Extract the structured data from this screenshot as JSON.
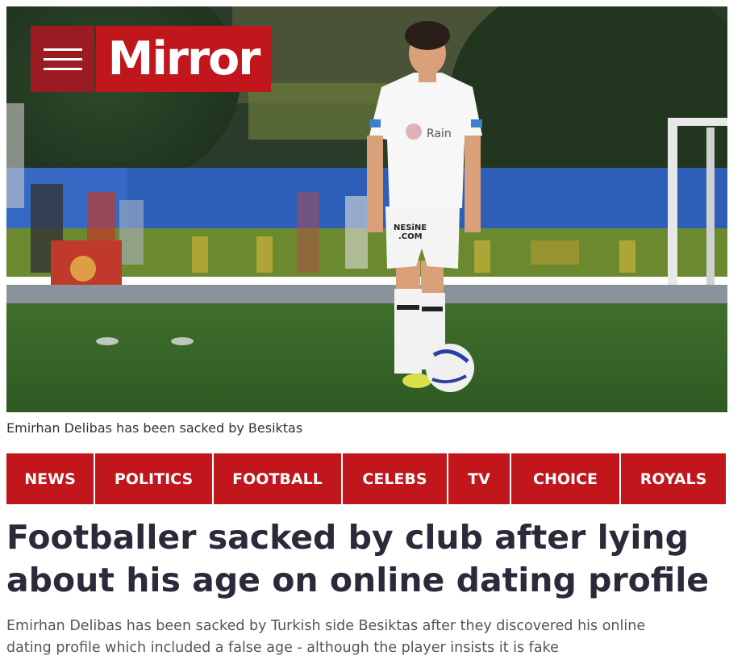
{
  "brand": {
    "logo_text": "Mirror",
    "primary_color": "#c1161c",
    "dark_color": "#9b1b22"
  },
  "masthead": {
    "menu_icon": "hamburger-menu-icon"
  },
  "hero": {
    "caption": "Emirhan Delibas has been sacked by Besiktas",
    "shirt_sponsor": "Rain",
    "shorts_sponsor_line1": "NESiNE",
    "shorts_sponsor_line2": ".COM"
  },
  "nav": {
    "items": [
      {
        "label": "NEWS"
      },
      {
        "label": "POLITICS"
      },
      {
        "label": "FOOTBALL"
      },
      {
        "label": "CELEBS"
      },
      {
        "label": "TV"
      },
      {
        "label": "CHOICE"
      },
      {
        "label": "ROYALS"
      }
    ]
  },
  "article": {
    "headline_line1": "Footballer sacked by club after lying",
    "headline_line2": "about his age on online dating profile",
    "standfirst_line1": "Emirhan Delibas has been sacked by Turkish side Besiktas after they discovered his online",
    "standfirst_line2": "dating profile which included a false age - although the player insists it is fake"
  }
}
